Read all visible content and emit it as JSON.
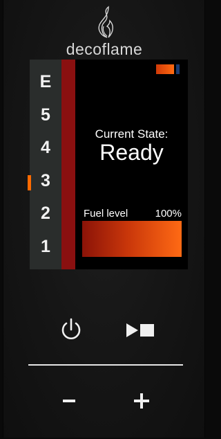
{
  "brand": {
    "name": "decoflame",
    "logo_icon": "flame-logo-icon"
  },
  "levels": {
    "items": [
      {
        "label": "E"
      },
      {
        "label": "5"
      },
      {
        "label": "4"
      },
      {
        "label": "3"
      },
      {
        "label": "2"
      },
      {
        "label": "1"
      }
    ],
    "selected": "3"
  },
  "status": {
    "state_label": "Current State:",
    "state_value": "Ready",
    "fuel_label": "Fuel level",
    "fuel_percent_text": "100%",
    "fuel_fraction": 1.0,
    "battery_icon": "battery-icon"
  },
  "controls": {
    "power_icon": "power-icon",
    "play_stop_icon": "play-stop-icon",
    "minus_icon": "minus-icon",
    "plus_icon": "plus-icon"
  },
  "colors": {
    "accent": "#ff6a00",
    "level_bar": "#8a1010",
    "panel": "#161616",
    "screen": "#000000"
  }
}
